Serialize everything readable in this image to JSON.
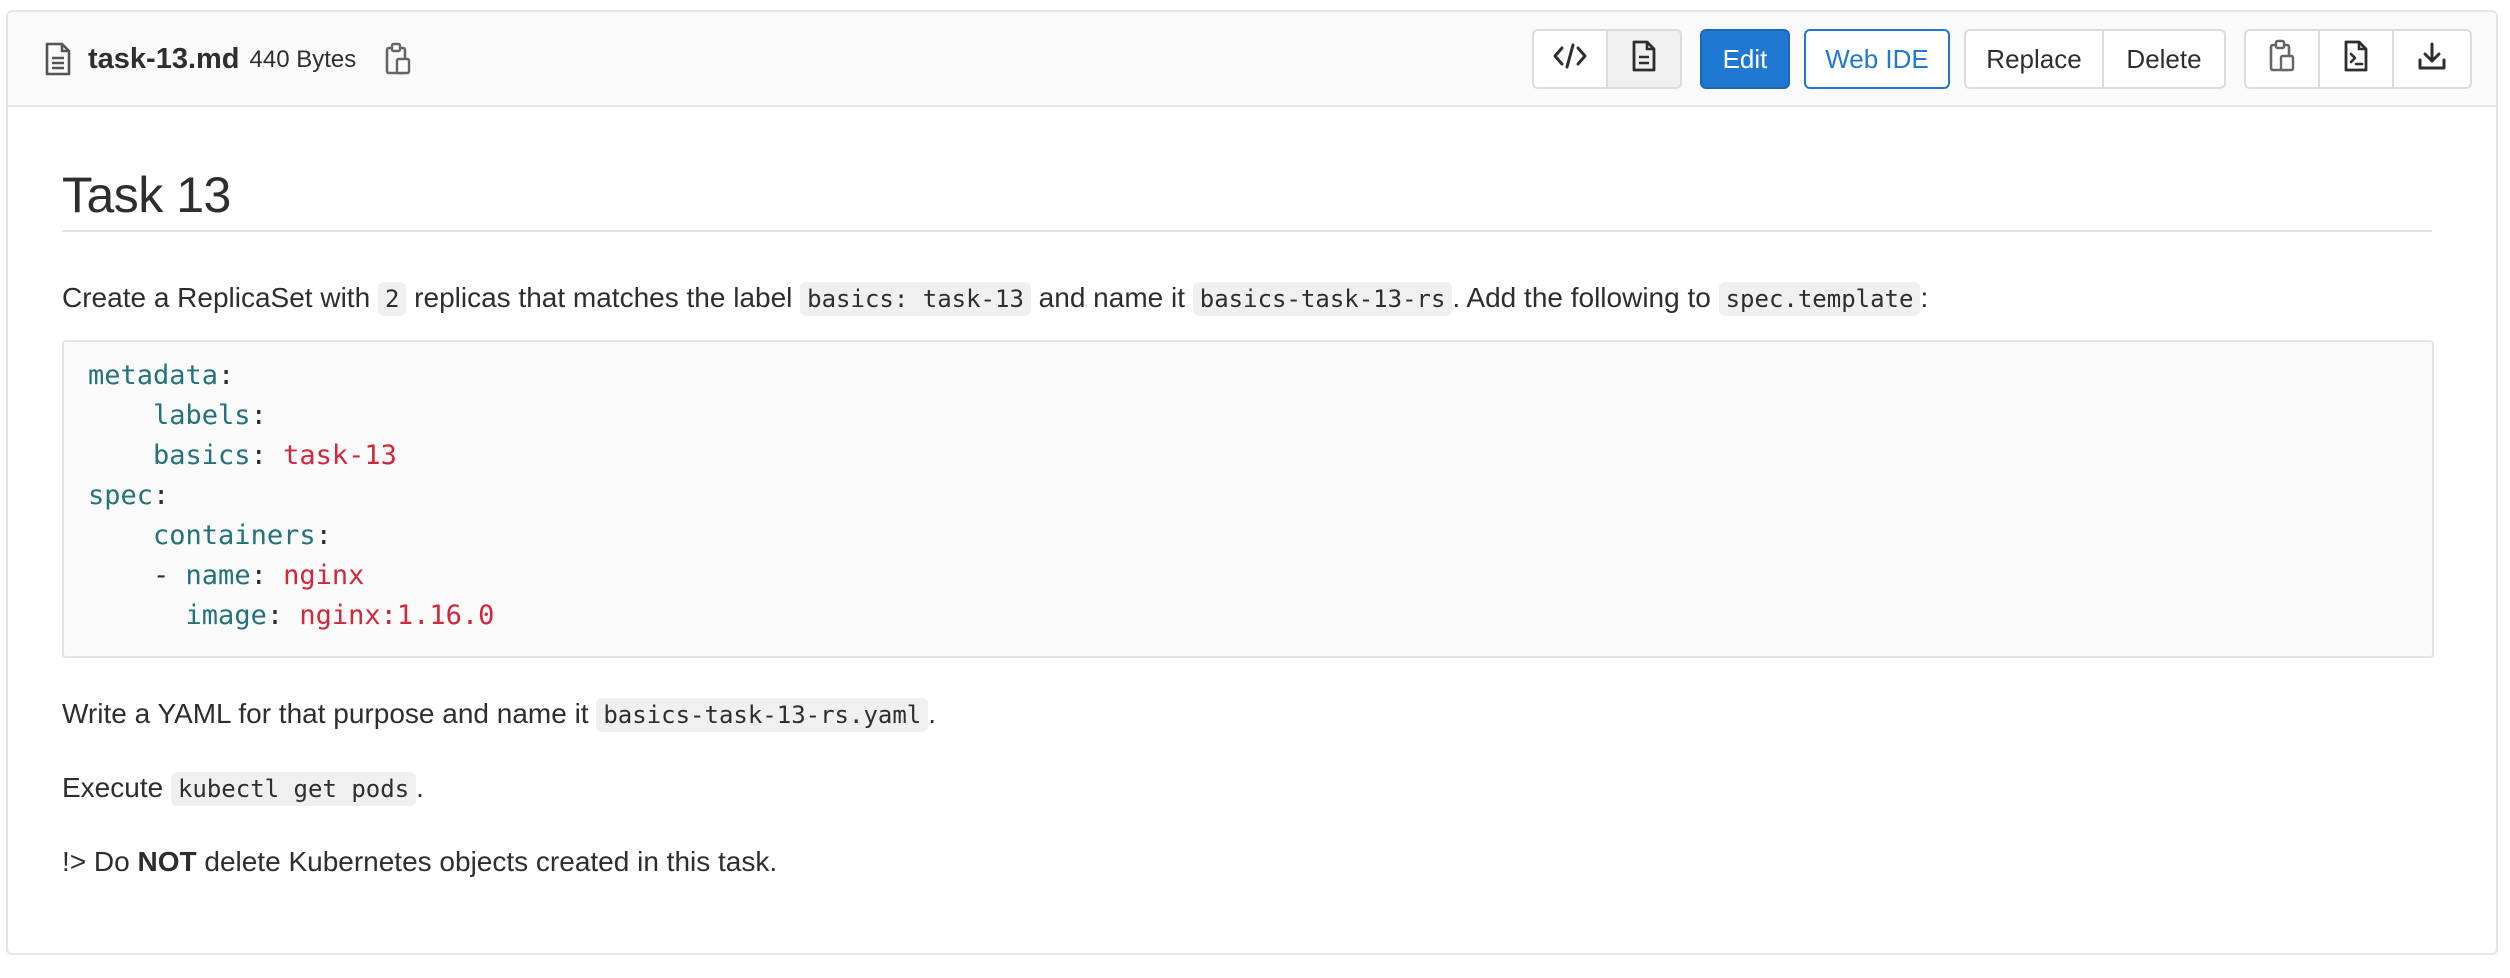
{
  "file": {
    "name": "task-13.md",
    "size": "440 Bytes"
  },
  "toolbar": {
    "edit_label": "Edit",
    "web_ide_label": "Web IDE",
    "replace_label": "Replace",
    "delete_label": "Delete"
  },
  "markdown": {
    "title": "Task 13",
    "p1": {
      "t1": "Create a ReplicaSet with ",
      "c1": "2",
      "t2": " replicas that matches the label ",
      "c2": "basics: task-13",
      "t3": " and name it ",
      "c3": "basics-task-13-rs",
      "t4": ". Add the following to ",
      "c4": "spec.template",
      "t5": ":"
    },
    "code": {
      "metadata": "metadata",
      "labels": "labels",
      "basics_key": "basics",
      "basics_val": "task-13",
      "spec": "spec",
      "containers": "containers",
      "dash": "- ",
      "name_key": "name",
      "name_val": "nginx",
      "image_key": "image",
      "image_val": "nginx:1.16.0"
    },
    "p2": {
      "t1": "Write a YAML for that purpose and name it ",
      "c1": "basics-task-13-rs.yaml",
      "t2": "."
    },
    "p3": {
      "t1": "Execute ",
      "c1": "kubectl get pods",
      "t2": "."
    },
    "p4": {
      "t1": "!> Do ",
      "strong": "NOT",
      "t2": " delete Kubernetes objects created in this task."
    }
  },
  "icons": {
    "file": "file-document-icon",
    "copy_path": "clipboard-copy-icon",
    "source": "code-icon",
    "rendered": "document-icon",
    "copy_contents": "clipboard-copy-icon",
    "raw": "raw-file-icon",
    "download": "download-icon"
  }
}
